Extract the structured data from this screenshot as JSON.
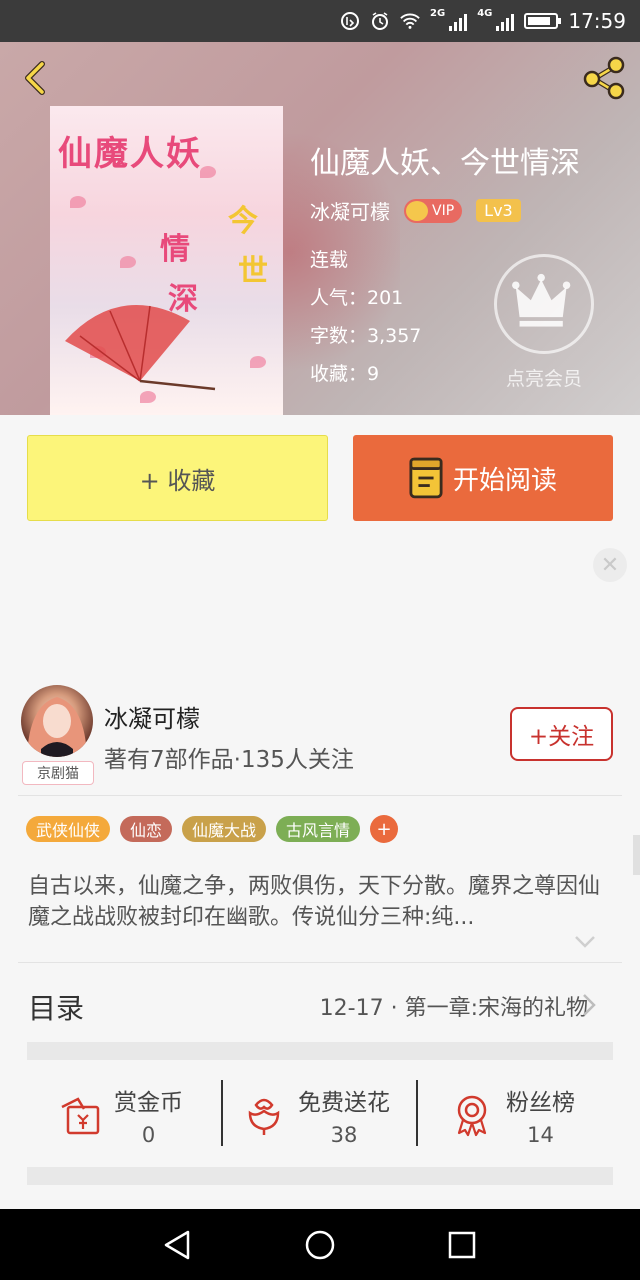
{
  "status_bar": {
    "time": "17:59",
    "network": "2G",
    "network2": "4G"
  },
  "book": {
    "title": "仙魔人妖、今世情深",
    "author": "冰凝可檬",
    "vip_label": "VIP",
    "level": "Lv3",
    "status": "连载",
    "popularity": "人气：201",
    "word_count": "字数：3,357",
    "favorites": "收藏：9",
    "cover_title": "仙魔人妖",
    "cover_v1": "今",
    "cover_v2": "世",
    "cover_v3": "情",
    "cover_v4": "深"
  },
  "member": {
    "label": "点亮会员"
  },
  "actions": {
    "collect": "+ 收藏",
    "read": "开始阅读"
  },
  "author_card": {
    "name": "冰凝可檬",
    "stats": "著有7部作品·135人关注",
    "badge": "京剧猫",
    "follow": "+关注"
  },
  "tags": [
    {
      "label": "武侠仙侠",
      "color": "#f4a93b"
    },
    {
      "label": "仙恋",
      "color": "#c46a5a"
    },
    {
      "label": "仙魔大战",
      "color": "#c9a14a"
    },
    {
      "label": "古风言情",
      "color": "#7dae55"
    }
  ],
  "tag_more": "+",
  "synopsis": "自古以来，仙魔之争，两败俱伤，天下分散。魔界之尊因仙魔之战战败被封印在幽歌。传说仙分三种:纯...",
  "toc": {
    "label": "目录",
    "latest": "12-17 · 第一章:宋海的礼物"
  },
  "stats": [
    {
      "label": "赏金币",
      "value": "0",
      "icon": "red-envelope-icon"
    },
    {
      "label": "免费送花",
      "value": "38",
      "icon": "flower-icon"
    },
    {
      "label": "粉丝榜",
      "value": "14",
      "icon": "medal-icon"
    }
  ],
  "colors": {
    "accent_orange": "#ea6a3d",
    "collect_yellow": "#fcf57a",
    "follow_red": "#c8322e"
  }
}
